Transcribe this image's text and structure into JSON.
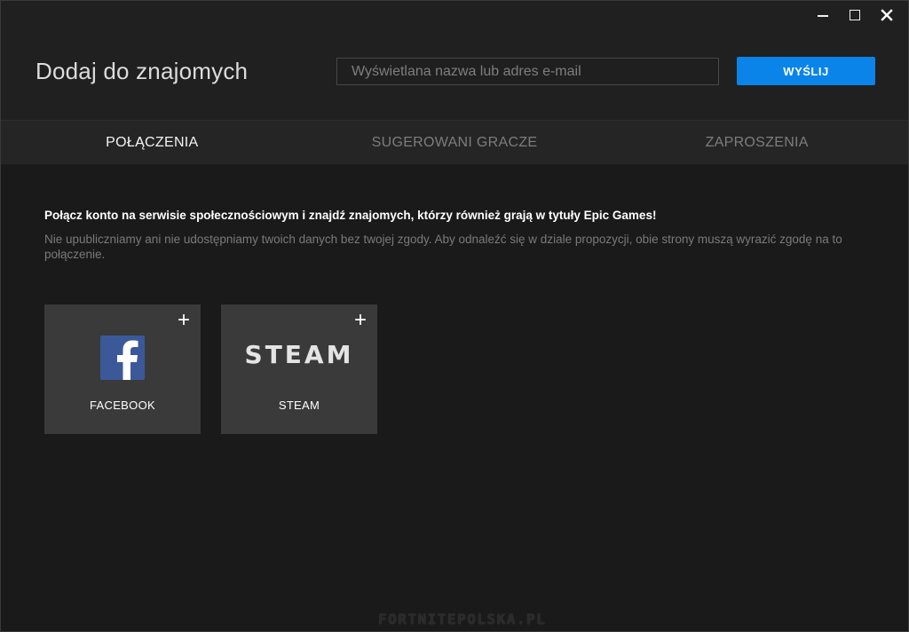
{
  "window": {
    "controls": {
      "minimize_icon": "minimize-icon",
      "maximize_icon": "maximize-icon",
      "close_icon": "close-icon"
    }
  },
  "header": {
    "title": "Dodaj do znajomych",
    "search": {
      "placeholder": "Wyświetlana nazwa lub adres e-mail",
      "value": ""
    },
    "send_label": "WYŚLIJ"
  },
  "tabs": [
    {
      "label": "POŁĄCZENIA",
      "active": true
    },
    {
      "label": "SUGEROWANI GRACZE",
      "active": false
    },
    {
      "label": "ZAPROSZENIA",
      "active": false
    }
  ],
  "content": {
    "heading": "Połącz konto na serwisie społecznościowym i znajdź znajomych, którzy również grają w tytuły Epic Games!",
    "description": "Nie upubliczniamy ani nie udostępniamy twoich danych bez twojej zgody. Aby odnaleźć się w dziale propozycji, obie strony muszą wyrazić zgodę na to połączenie.",
    "cards": [
      {
        "label": "FACEBOOK",
        "icon": "facebook-logo-icon",
        "add_symbol": "+"
      },
      {
        "label": "STEAM",
        "logo_text": "STEAM",
        "icon": "steam-logo",
        "add_symbol": "+"
      }
    ]
  },
  "watermark": "FORTNITEPOLSKA.PL",
  "colors": {
    "background": "#1a1a1a",
    "header": "#202020",
    "tabs": "#252525",
    "card": "#3a3a3a",
    "accent": "#0a84e8",
    "facebook": "#3b5998"
  }
}
